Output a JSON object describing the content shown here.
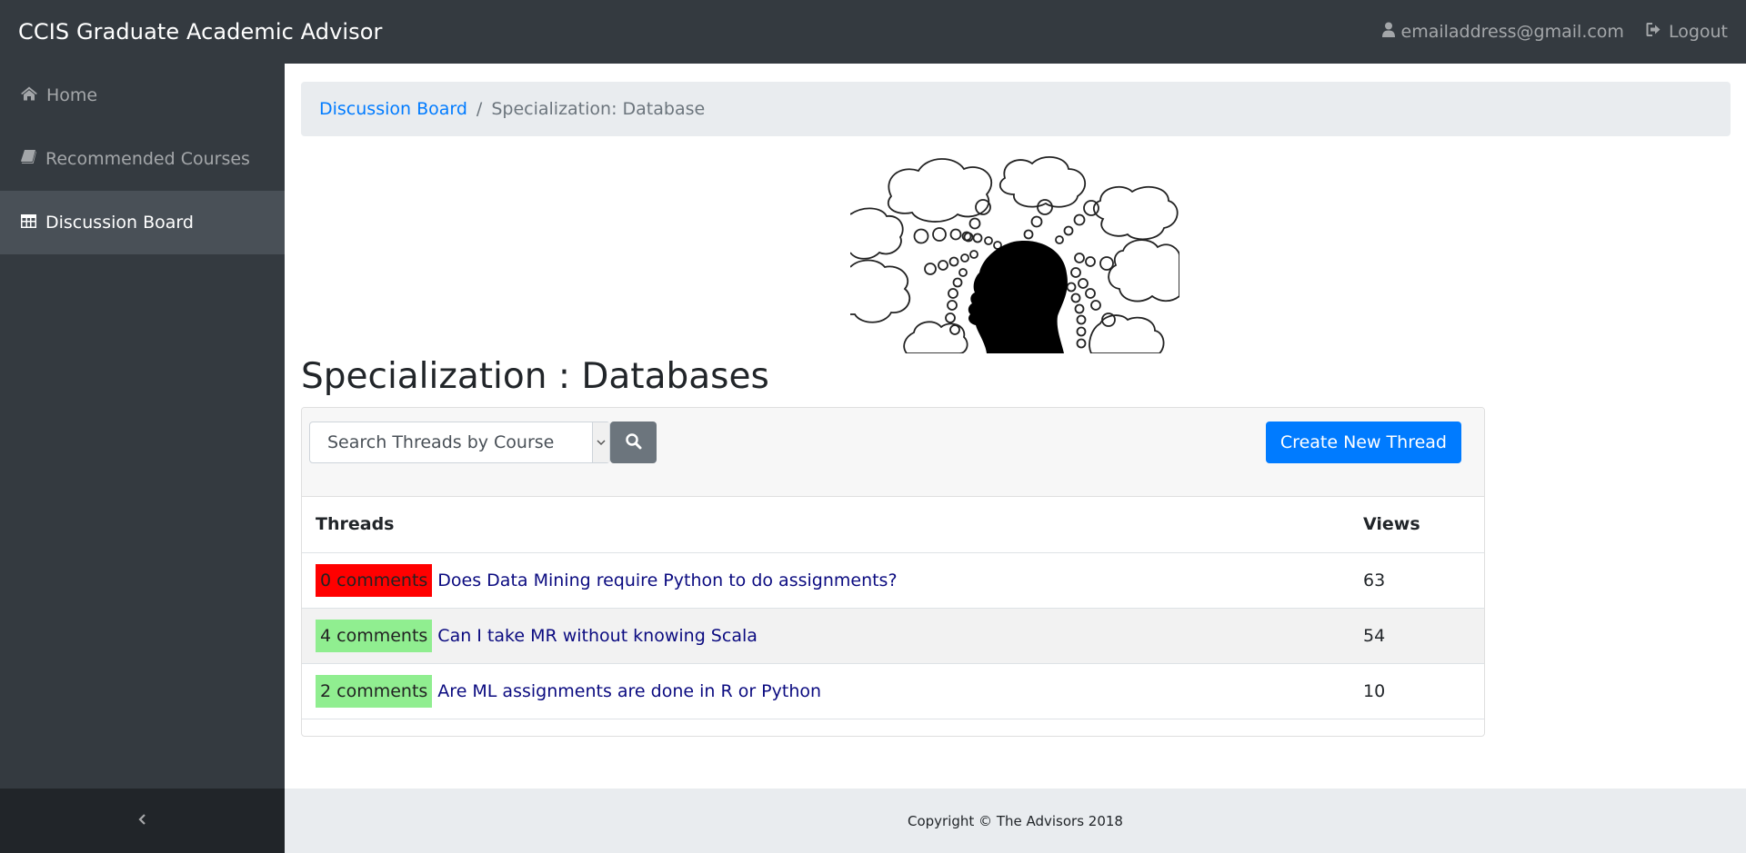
{
  "navbar": {
    "brand": "CCIS Graduate Academic Advisor",
    "email": "emailaddress@gmail.com",
    "logout": "Logout"
  },
  "sidebar": {
    "items": [
      {
        "label": "Home",
        "icon": "home-icon"
      },
      {
        "label": "Recommended Courses",
        "icon": "book-icon"
      },
      {
        "label": "Discussion Board",
        "icon": "table-icon",
        "active": true
      }
    ],
    "toggle_icon": "chevron-left-icon"
  },
  "breadcrumb": {
    "link": "Discussion Board",
    "separator": "/",
    "current": "Specialization: Database"
  },
  "page": {
    "title": "Specialization : Databases"
  },
  "toolbar": {
    "search_placeholder": "Search Threads by Course",
    "create_label": "Create New Thread"
  },
  "table": {
    "headers": {
      "threads": "Threads",
      "views": "Views"
    },
    "rows": [
      {
        "comments": "0 comments",
        "comment_count": 0,
        "title": "Does Data Mining require Python to do assignments?",
        "views": "63"
      },
      {
        "comments": "4 comments",
        "comment_count": 4,
        "title": "Can I take MR without knowing Scala",
        "views": "54"
      },
      {
        "comments": "2 comments",
        "comment_count": 2,
        "title": "Are ML assignments are done in R or Python",
        "views": "10"
      }
    ]
  },
  "footer": {
    "copyright": "Copyright © The Advisors 2018"
  },
  "colors": {
    "navbar": "#343a40",
    "primary": "#007bff",
    "badge_zero": "#ff0000",
    "badge_some": "#90ee90"
  }
}
